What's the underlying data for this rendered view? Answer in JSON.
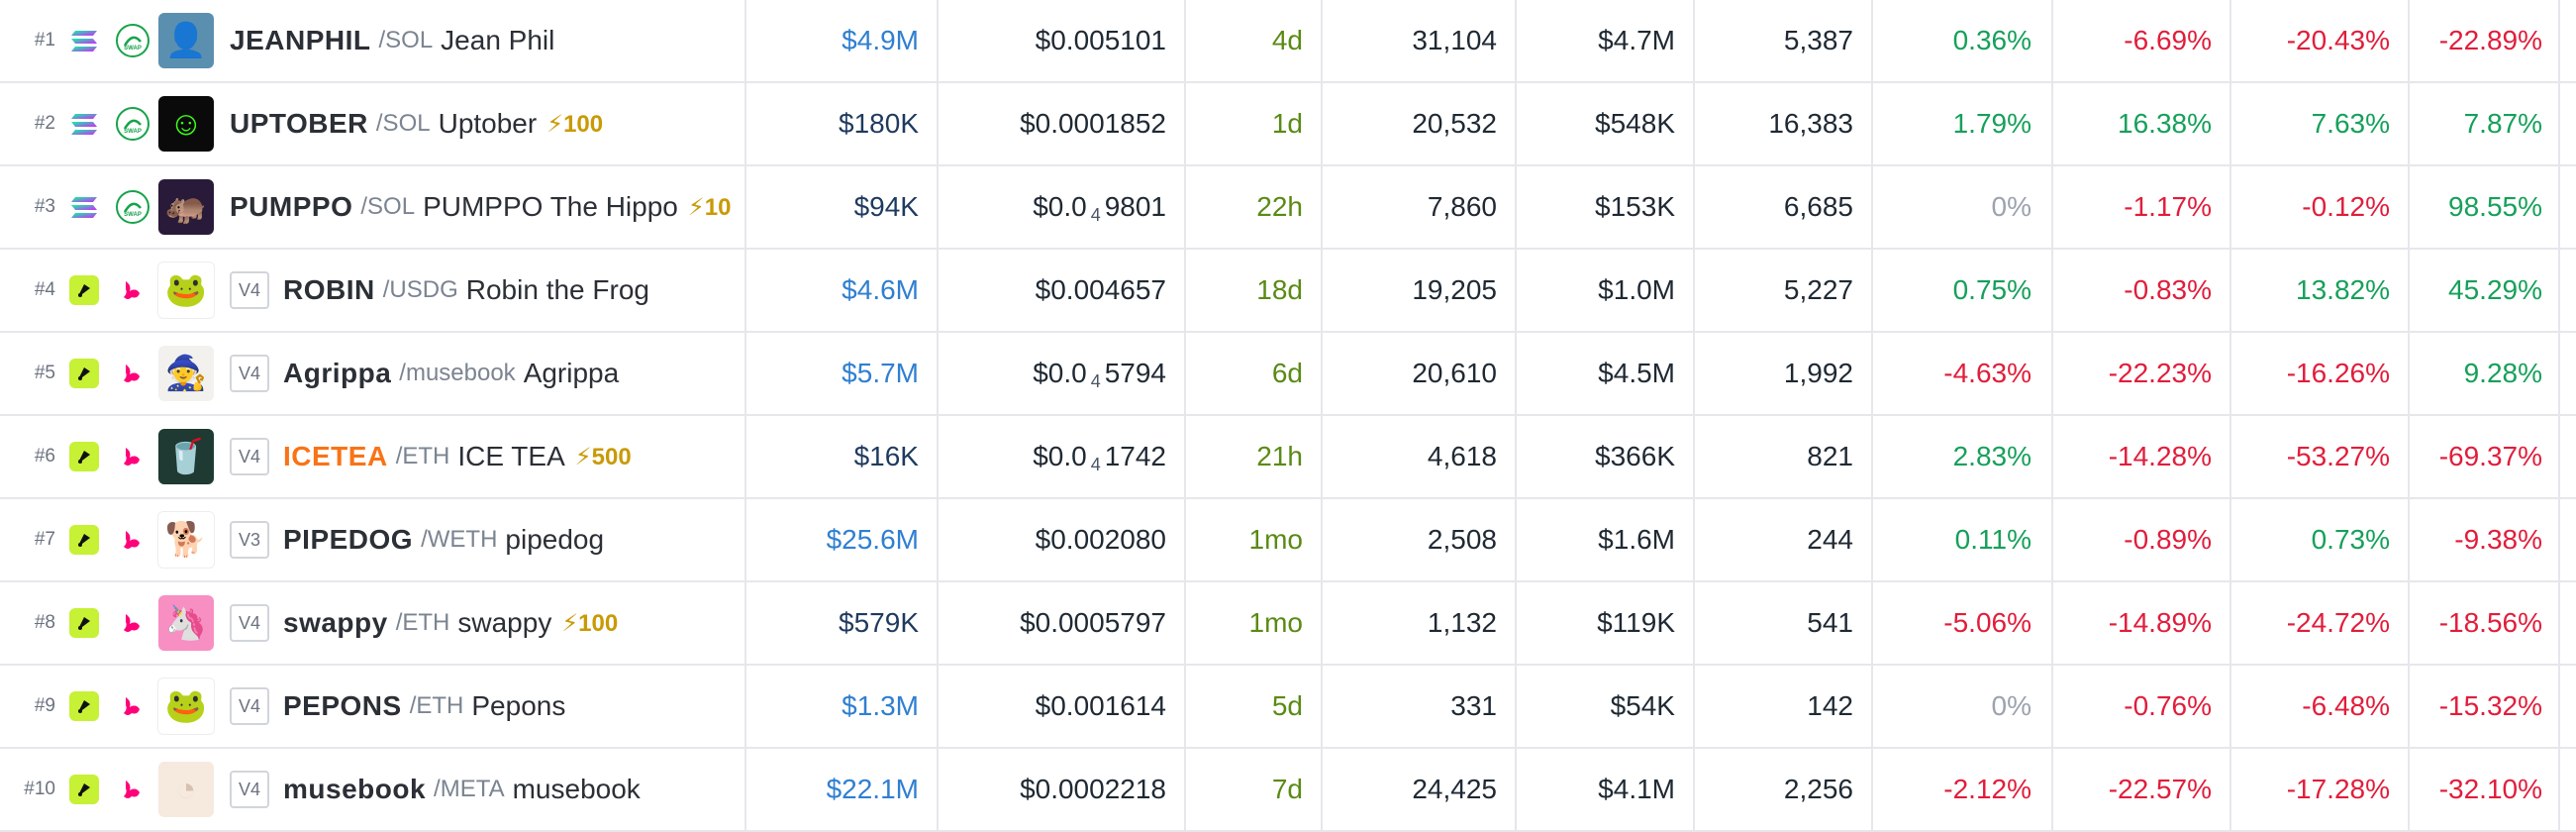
{
  "colors": {
    "blue": "#2f7fd1",
    "green": "#16a05a",
    "red": "#e11d3b",
    "gray": "#9ca3af",
    "orange": "#f97316",
    "boost": "#c99a06",
    "solana_chain": "#9945ff",
    "lime_chain": "#c6f135",
    "uniswap": "#ff007a"
  },
  "rows": [
    {
      "rank": "#1",
      "chain_icon": "solana-icon",
      "dex_icon": "raydium-swap-icon",
      "avatar_icon": "jeanphil-avatar",
      "version": "",
      "symbol": "JEANPHIL",
      "quote": "/SOL",
      "name": "Jean Phil",
      "boost": "",
      "liquidity": "$4.9M",
      "liquidity_color": "blue",
      "price_prefix": "$0.005101",
      "price_zeros": "",
      "price_rest": "",
      "age": "4d",
      "txns": "31,104",
      "volume": "$4.7M",
      "makers": "5,387",
      "p1": "0.36%",
      "p1_color": "green",
      "p2": "-6.69%",
      "p2_color": "red",
      "p3": "-20.43%",
      "p3_color": "red",
      "p4": "-22.89%",
      "p4_color": "red"
    },
    {
      "rank": "#2",
      "chain_icon": "solana-icon",
      "dex_icon": "raydium-swap-icon",
      "avatar_icon": "uptober-avatar",
      "version": "",
      "symbol": "UPTOBER",
      "quote": "/SOL",
      "name": "Uptober",
      "boost": "⚡100",
      "liquidity": "$180K",
      "liquidity_color": "navy",
      "price_prefix": "$0.0001852",
      "price_zeros": "",
      "price_rest": "",
      "age": "1d",
      "txns": "20,532",
      "volume": "$548K",
      "makers": "16,383",
      "p1": "1.79%",
      "p1_color": "green",
      "p2": "16.38%",
      "p2_color": "green",
      "p3": "7.63%",
      "p3_color": "green",
      "p4": "7.87%",
      "p4_color": "green"
    },
    {
      "rank": "#3",
      "chain_icon": "solana-icon",
      "dex_icon": "raydium-swap-icon",
      "avatar_icon": "pumppo-avatar",
      "version": "",
      "symbol": "PUMPPO",
      "quote": "/SOL",
      "name": "PUMPPO The Hippo",
      "boost": "⚡10",
      "liquidity": "$94K",
      "liquidity_color": "navy",
      "price_prefix": "$0.0",
      "price_zeros": "4",
      "price_rest": "9801",
      "age": "22h",
      "txns": "7,860",
      "volume": "$153K",
      "makers": "6,685",
      "p1": "0%",
      "p1_color": "gray",
      "p2": "-1.17%",
      "p2_color": "red",
      "p3": "-0.12%",
      "p3_color": "red",
      "p4": "98.55%",
      "p4_color": "green"
    },
    {
      "rank": "#4",
      "chain_icon": "lime-chain-icon",
      "dex_icon": "uniswap-icon",
      "avatar_icon": "robin-avatar",
      "version": "V4",
      "symbol": "ROBIN",
      "quote": "/USDG",
      "name": "Robin the Frog",
      "boost": "",
      "liquidity": "$4.6M",
      "liquidity_color": "blue",
      "price_prefix": "$0.004657",
      "price_zeros": "",
      "price_rest": "",
      "age": "18d",
      "txns": "19,205",
      "volume": "$1.0M",
      "makers": "5,227",
      "p1": "0.75%",
      "p1_color": "green",
      "p2": "-0.83%",
      "p2_color": "red",
      "p3": "13.82%",
      "p3_color": "green",
      "p4": "45.29%",
      "p4_color": "green"
    },
    {
      "rank": "#5",
      "chain_icon": "lime-chain-icon",
      "dex_icon": "uniswap-icon",
      "avatar_icon": "agrippa-avatar",
      "version": "V4",
      "symbol": "Agrippa",
      "quote": "/musebook",
      "name": "Agrippa",
      "boost": "",
      "liquidity": "$5.7M",
      "liquidity_color": "blue",
      "price_prefix": "$0.0",
      "price_zeros": "4",
      "price_rest": "5794",
      "age": "6d",
      "txns": "20,610",
      "volume": "$4.5M",
      "makers": "1,992",
      "p1": "-4.63%",
      "p1_color": "red",
      "p2": "-22.23%",
      "p2_color": "red",
      "p3": "-16.26%",
      "p3_color": "red",
      "p4": "9.28%",
      "p4_color": "green"
    },
    {
      "rank": "#6",
      "chain_icon": "lime-chain-icon",
      "dex_icon": "uniswap-icon",
      "avatar_icon": "icetea-avatar",
      "version": "V4",
      "symbol": "ICETEA",
      "quote": "/ETH",
      "name": "ICE TEA",
      "boost": "⚡500",
      "liquidity": "$16K",
      "liquidity_color": "navy",
      "price_prefix": "$0.0",
      "price_zeros": "4",
      "price_rest": "1742",
      "age": "21h",
      "txns": "4,618",
      "volume": "$366K",
      "makers": "821",
      "p1": "2.83%",
      "p1_color": "green",
      "p2": "-14.28%",
      "p2_color": "red",
      "p3": "-53.27%",
      "p3_color": "red",
      "p4": "-69.37%",
      "p4_color": "red"
    },
    {
      "rank": "#7",
      "chain_icon": "lime-chain-icon",
      "dex_icon": "uniswap-icon",
      "avatar_icon": "pipedog-avatar",
      "version": "V3",
      "symbol": "PIPEDOG",
      "quote": "/WETH",
      "name": "pipedog",
      "boost": "",
      "liquidity": "$25.6M",
      "liquidity_color": "blue",
      "price_prefix": "$0.002080",
      "price_zeros": "",
      "price_rest": "",
      "age": "1mo",
      "txns": "2,508",
      "volume": "$1.6M",
      "makers": "244",
      "p1": "0.11%",
      "p1_color": "green",
      "p2": "-0.89%",
      "p2_color": "red",
      "p3": "0.73%",
      "p3_color": "green",
      "p4": "-9.38%",
      "p4_color": "red"
    },
    {
      "rank": "#8",
      "chain_icon": "lime-chain-icon",
      "dex_icon": "uniswap-icon",
      "avatar_icon": "swappy-avatar",
      "version": "V4",
      "symbol": "swappy",
      "quote": "/ETH",
      "name": "swappy",
      "boost": "⚡100",
      "liquidity": "$579K",
      "liquidity_color": "navy",
      "price_prefix": "$0.0005797",
      "price_zeros": "",
      "price_rest": "",
      "age": "1mo",
      "txns": "1,132",
      "volume": "$119K",
      "makers": "541",
      "p1": "-5.06%",
      "p1_color": "red",
      "p2": "-14.89%",
      "p2_color": "red",
      "p3": "-24.72%",
      "p3_color": "red",
      "p4": "-18.56%",
      "p4_color": "red"
    },
    {
      "rank": "#9",
      "chain_icon": "lime-chain-icon",
      "dex_icon": "uniswap-icon",
      "avatar_icon": "pepons-avatar",
      "version": "V4",
      "symbol": "PEPONS",
      "quote": "/ETH",
      "name": "Pepons",
      "boost": "",
      "liquidity": "$1.3M",
      "liquidity_color": "blue",
      "price_prefix": "$0.001614",
      "price_zeros": "",
      "price_rest": "",
      "age": "5d",
      "txns": "331",
      "volume": "$54K",
      "makers": "142",
      "p1": "0%",
      "p1_color": "gray",
      "p2": "-0.76%",
      "p2_color": "red",
      "p3": "-6.48%",
      "p3_color": "red",
      "p4": "-15.32%",
      "p4_color": "red"
    },
    {
      "rank": "#10",
      "chain_icon": "lime-chain-icon",
      "dex_icon": "uniswap-icon",
      "avatar_icon": "musebook-avatar",
      "version": "V4",
      "symbol": "musebook",
      "quote": "/META",
      "name": "musebook",
      "boost": "",
      "liquidity": "$22.1M",
      "liquidity_color": "blue",
      "price_prefix": "$0.0002218",
      "price_zeros": "",
      "price_rest": "",
      "age": "7d",
      "txns": "24,425",
      "volume": "$4.1M",
      "makers": "2,256",
      "p1": "-2.12%",
      "p1_color": "red",
      "p2": "-22.57%",
      "p2_color": "red",
      "p3": "-17.28%",
      "p3_color": "red",
      "p4": "-32.10%",
      "p4_color": "red"
    }
  ]
}
